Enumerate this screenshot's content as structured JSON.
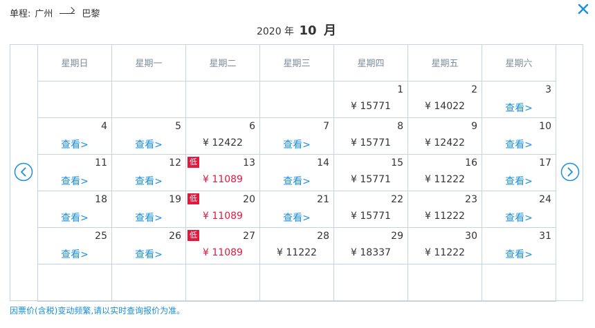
{
  "header": {
    "route_label": "单程:",
    "origin": "广州",
    "destination": "巴黎",
    "year_label": "2020 年",
    "month_num": "10",
    "month_unit": "月"
  },
  "weekdays": [
    "星期日",
    "星期一",
    "星期二",
    "星期三",
    "星期四",
    "星期五",
    "星期六"
  ],
  "view_label": "查看>",
  "low_label": "低",
  "colors": {
    "accent": "#1a8fdc",
    "low": "#e4183e",
    "grid": "#c7d3e0"
  },
  "weeks": [
    [
      null,
      null,
      null,
      null,
      {
        "day": "1",
        "price": "¥ 15771"
      },
      {
        "day": "2",
        "price": "¥ 14022"
      },
      {
        "day": "3",
        "view": true
      }
    ],
    [
      {
        "day": "4",
        "view": true
      },
      {
        "day": "5",
        "view": true
      },
      {
        "day": "6",
        "price": "¥ 12422"
      },
      {
        "day": "7",
        "view": true
      },
      {
        "day": "8",
        "price": "¥ 15771"
      },
      {
        "day": "9",
        "price": "¥ 12422"
      },
      {
        "day": "10",
        "view": true
      }
    ],
    [
      {
        "day": "11",
        "view": true
      },
      {
        "day": "12",
        "view": true
      },
      {
        "day": "13",
        "price": "¥ 11089",
        "low": true
      },
      {
        "day": "14",
        "view": true
      },
      {
        "day": "15",
        "price": "¥ 15771"
      },
      {
        "day": "16",
        "price": "¥ 11222"
      },
      {
        "day": "17",
        "view": true
      }
    ],
    [
      {
        "day": "18",
        "view": true
      },
      {
        "day": "19",
        "view": true
      },
      {
        "day": "20",
        "price": "¥ 11089",
        "low": true
      },
      {
        "day": "21",
        "view": true
      },
      {
        "day": "22",
        "price": "¥ 15771"
      },
      {
        "day": "23",
        "price": "¥ 11222"
      },
      {
        "day": "24",
        "view": true
      }
    ],
    [
      {
        "day": "25",
        "view": true
      },
      {
        "day": "26",
        "view": true
      },
      {
        "day": "27",
        "price": "¥ 11089",
        "low": true
      },
      {
        "day": "28",
        "price": "¥ 11222"
      },
      {
        "day": "29",
        "price": "¥ 18337"
      },
      {
        "day": "30",
        "price": "¥ 11222"
      },
      {
        "day": "31",
        "view": true
      }
    ],
    [
      null,
      null,
      null,
      null,
      null,
      null,
      null
    ]
  ],
  "footnote": "因票价(含税)变动频繁,请以实时查询报价为准。"
}
